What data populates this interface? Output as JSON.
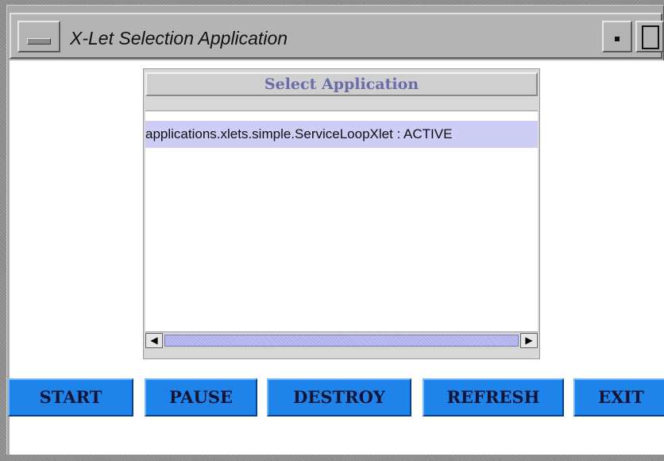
{
  "window": {
    "title": "X-Let Selection Application"
  },
  "panel": {
    "header": "Select Application",
    "items": [
      {
        "label": "applications.xlets.simple.ServiceLoopXlet : ACTIVE",
        "selected": true
      }
    ]
  },
  "scrollbar": {
    "left_arrow": "◀",
    "right_arrow": "▶"
  },
  "buttons": {
    "start": "START",
    "pause": "PAUSE",
    "destroy": "DESTROY",
    "refresh": "REFRESH",
    "exit": "EXIT"
  },
  "colors": {
    "button_bg": "#1f84ea",
    "selection_bg": "#cdcdf5",
    "header_text": "#6b6ba8"
  },
  "icons": {
    "window_menu": "window-menu-icon",
    "minimize": "minimize-icon",
    "maximize": "maximize-icon"
  }
}
